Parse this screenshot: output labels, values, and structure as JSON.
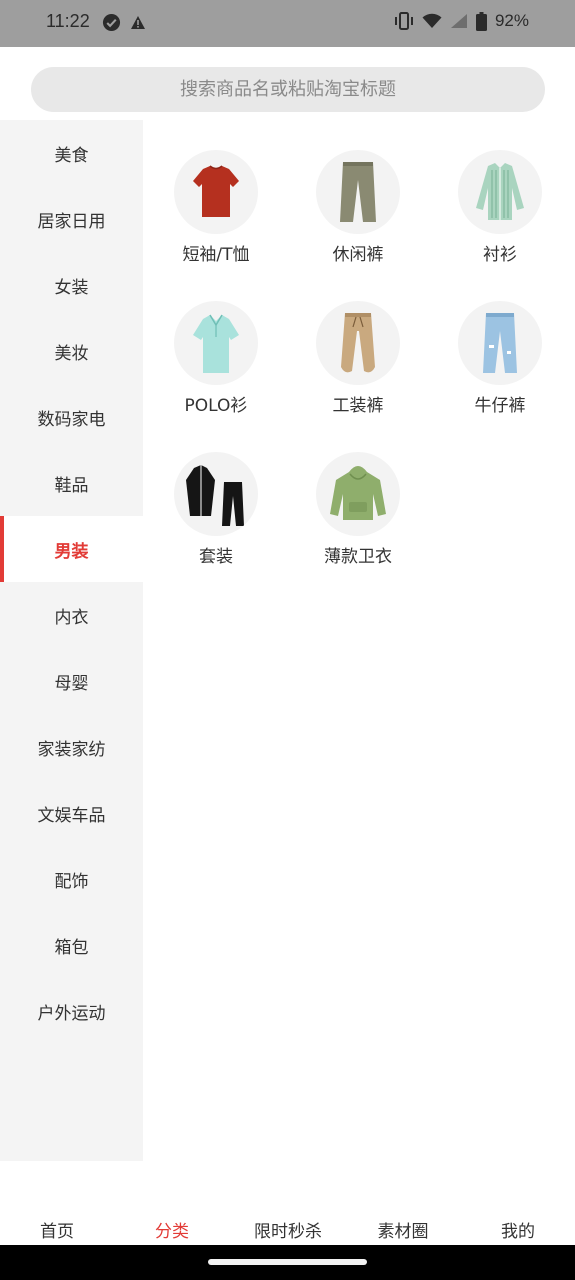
{
  "status_bar": {
    "time": "11:22",
    "battery": "92%",
    "icons": [
      "check-circle-icon",
      "alert-icon",
      "vibrate-icon",
      "wifi-icon",
      "signal-icon",
      "battery-icon"
    ]
  },
  "search": {
    "placeholder": "搜索商品名或粘贴淘宝标题"
  },
  "sidebar": {
    "items": [
      {
        "label": "美食"
      },
      {
        "label": "居家日用"
      },
      {
        "label": "女装"
      },
      {
        "label": "美妆"
      },
      {
        "label": "数码家电"
      },
      {
        "label": "鞋品"
      },
      {
        "label": "男装",
        "active": true
      },
      {
        "label": "内衣"
      },
      {
        "label": "母婴"
      },
      {
        "label": "家装家纺"
      },
      {
        "label": "文娱车品"
      },
      {
        "label": "配饰"
      },
      {
        "label": "箱包"
      },
      {
        "label": "户外运动"
      }
    ],
    "active_color": "#e23b36"
  },
  "categories": [
    {
      "label": "短袖/T恤",
      "icon": "tshirt-icon"
    },
    {
      "label": "休闲裤",
      "icon": "casual-pants-icon"
    },
    {
      "label": "衬衫",
      "icon": "shirt-icon"
    },
    {
      "label": "POLO衫",
      "icon": "polo-shirt-icon"
    },
    {
      "label": "工装裤",
      "icon": "cargo-pants-icon"
    },
    {
      "label": "牛仔裤",
      "icon": "jeans-icon"
    },
    {
      "label": "套装",
      "icon": "tracksuit-icon"
    },
    {
      "label": "薄款卫衣",
      "icon": "hoodie-icon"
    }
  ],
  "tabbar": {
    "tabs": [
      {
        "label": "首页"
      },
      {
        "label": "分类",
        "active": true
      },
      {
        "label": "限时秒杀"
      },
      {
        "label": "素材圈"
      },
      {
        "label": "我的"
      }
    ]
  }
}
